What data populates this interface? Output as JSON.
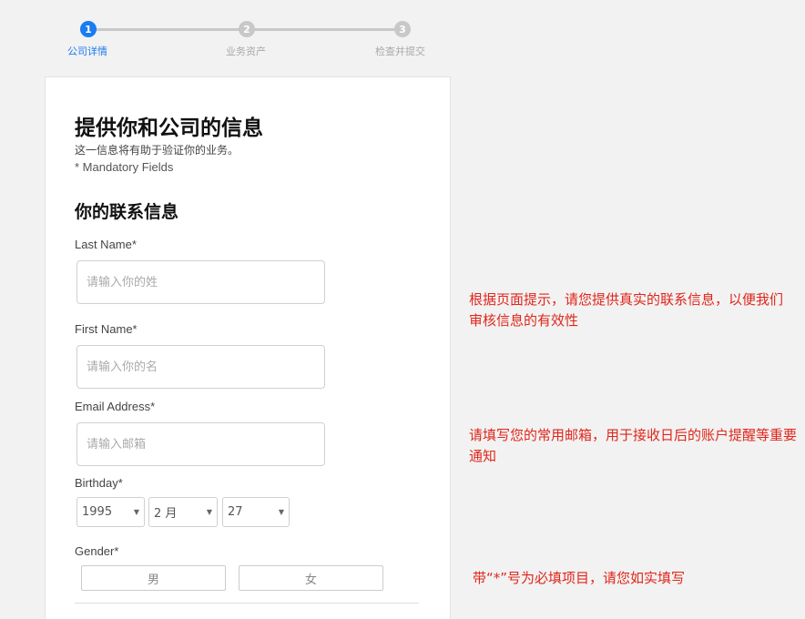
{
  "stepper": {
    "steps": [
      {
        "number": "1",
        "label": "公司详情"
      },
      {
        "number": "2",
        "label": "业务资产"
      },
      {
        "number": "3",
        "label": "检查并提交"
      }
    ]
  },
  "form": {
    "title": "提供你和公司的信息",
    "subtitle": "这一信息将有助于验证你的业务。",
    "mandatory_note": "* Mandatory Fields",
    "section_title": "你的联系信息",
    "last_name": {
      "label": "Last Name*",
      "placeholder": "请输入你的姓",
      "value": ""
    },
    "first_name": {
      "label": "First Name*",
      "placeholder": "请输入你的名",
      "value": ""
    },
    "email": {
      "label": "Email Address*",
      "placeholder": "请输入邮箱",
      "value": ""
    },
    "birthday": {
      "label": "Birthday*",
      "year": "1995",
      "month": "2 月",
      "day": "27"
    },
    "gender": {
      "label": "Gender*",
      "male": "男",
      "female": "女"
    }
  },
  "annotations": {
    "note1": "根据页面提示，请您提供真实的联系信息，以便我们审核信息的有效性",
    "note2": "请填写您的常用邮箱，用于接收日后的账户提醒等重要通知",
    "note3": "带“*”号为必填项目，请您如实填写"
  },
  "colors": {
    "accent": "#1a7cf0",
    "annotation": "#e0261b",
    "inactive_step": "#c8c8c8"
  }
}
